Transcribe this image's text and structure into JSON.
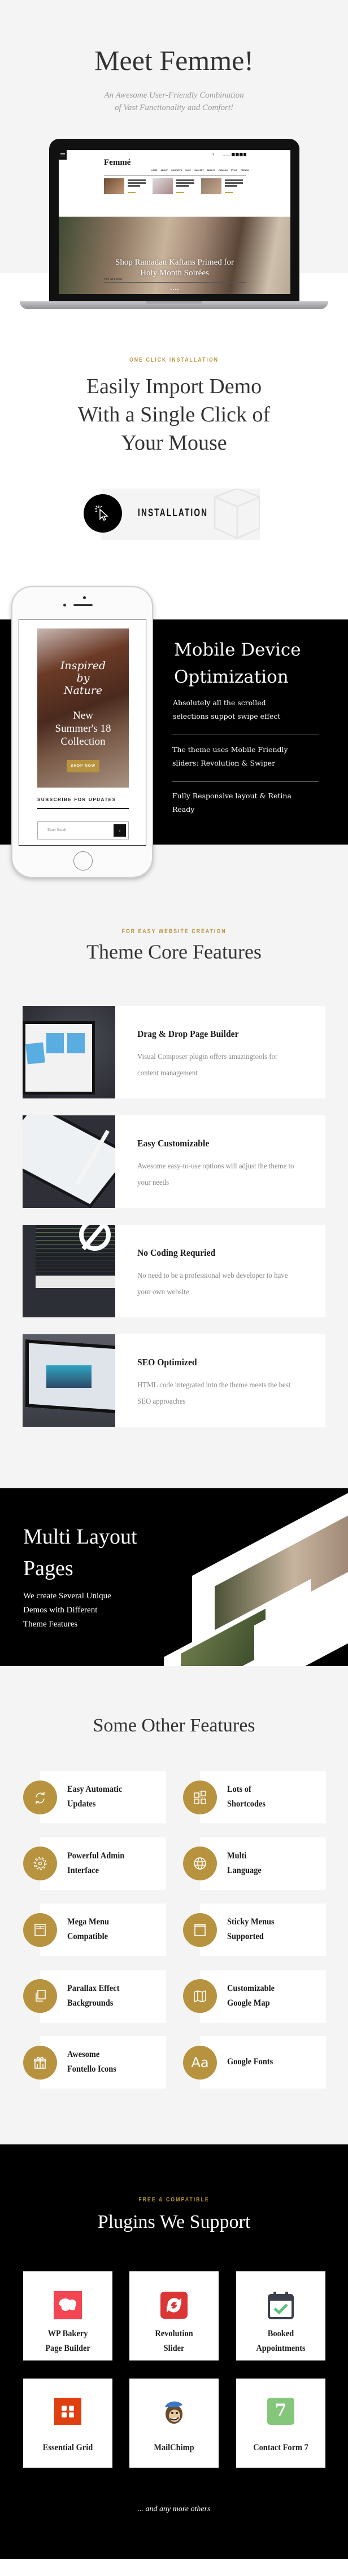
{
  "colors": {
    "accent": "#b8933f",
    "dark": "#000000",
    "light_bg": "#f4f4f4"
  },
  "hero": {
    "title": "Meet Femme!",
    "subtitle_line1": "An Awesome User-Friendly Combination",
    "subtitle_line2": "of Vast Functionality  and Comfort!"
  },
  "laptop_demo": {
    "logo": "Femmé",
    "subscribe": "Subscribe",
    "nav": [
      "HOME",
      "ABOUT",
      "CONTACTS",
      "SHOP",
      "GALLERY",
      "BEAUTY",
      "FASHION",
      "STYLE",
      "TRENDS"
    ],
    "slider_title_line1": "Shop Ramadan Kaftans Primed for",
    "slider_title_line2": "Holy Month Soirées",
    "section_label": "TOP STORIES"
  },
  "installation": {
    "label": "ONE CLICK INSTALLATION",
    "title_line1": "Easily Import Demo",
    "title_line2": "With a Single Click of",
    "title_line3": "Your Mouse",
    "button": "INSTALLATION",
    "button_icon": "cursor-click-icon"
  },
  "mobile": {
    "phone_screen": {
      "script_line1": "Inspired",
      "script_line2": "by",
      "script_line3": "Nature",
      "headline_line1": "New",
      "headline_line2": "Summer's 18",
      "headline_line3": "Collection",
      "shop_button": "SHOP NOW",
      "subscribe_label": "SUBSCRIBE FOR UPDATES",
      "email_placeholder": "Enter Email",
      "submit": "›"
    },
    "title_line1": "Mobile Device",
    "title_line2": "Optimization",
    "points": [
      {
        "line1": "Absolutely all the scrolled",
        "line2": "selections suppot swipe effect"
      },
      {
        "line1": "The theme uses Mobile Friendly",
        "line2": "sliders: Revolution & Swiper"
      },
      {
        "line1": "Fully Responsive layout & Retina",
        "line2": "Ready"
      }
    ]
  },
  "core": {
    "label": "FOR EASY WEBSITE CREATION",
    "title": "Theme Core Features",
    "items": [
      {
        "title": "Drag & Drop Page  Builder",
        "desc": "Visual  Composer plugin offers amazingtools for content management"
      },
      {
        "title": "Easy Customizable",
        "desc": "Awesome easy-to-use options will adjust the theme to your needs"
      },
      {
        "title": "No Coding Requried",
        "desc": "No need to be a professional web developer to have your own website"
      },
      {
        "title": "SEO Optimized",
        "desc": "HTML code integrated into the theme meets the best SEO approaches"
      }
    ]
  },
  "multi": {
    "title_line1": "Multi Layout",
    "title_line2": "Pages",
    "desc_line1": "We create Several Unique",
    "desc_line2": "Demos with Different",
    "desc_line3": "Theme Features"
  },
  "other": {
    "title": "Some Other Features",
    "items": [
      {
        "line1": "Easy  Automatic",
        "line2": "Updates",
        "icon": "refresh-icon"
      },
      {
        "line1": "Lots of",
        "line2": "Shortcodes",
        "icon": "shortcodes-icon"
      },
      {
        "line1": "Powerful Admin",
        "line2": "Interface",
        "icon": "gear-icon"
      },
      {
        "line1": "Multi",
        "line2": "Language",
        "icon": "globe-icon"
      },
      {
        "line1": "Mega Menu",
        "line2": "Compatible",
        "icon": "mega-menu-icon"
      },
      {
        "line1": "Sticky Menus",
        "line2": "Supported",
        "icon": "sticky-menu-icon"
      },
      {
        "line1": "Parallax Effect",
        "line2": "Backgrounds",
        "icon": "layers-icon"
      },
      {
        "line1": "Customizable",
        "line2": "Google Map",
        "icon": "map-icon"
      },
      {
        "line1": "Awesome",
        "line2": "Fontello Icons",
        "icon": "gift-icon"
      },
      {
        "line1": "Google Fonts",
        "line2": "",
        "icon": "font-icon",
        "glyph": "Aa"
      }
    ]
  },
  "plugins": {
    "label": "FREE & COMPATIBLE",
    "title": "Plugins We Support",
    "items": [
      {
        "line1": "WP Bakery",
        "line2": "Page Builder",
        "icon": "wpbakery-icon",
        "color": "#f24652"
      },
      {
        "line1": "Revolution",
        "line2": "Slider",
        "icon": "revolution-slider-icon",
        "color": "#dc3535"
      },
      {
        "line1": "Booked",
        "line2": "Appointments",
        "icon": "calendar-check-icon",
        "color": "#3a3f4b"
      },
      {
        "line1": "Essential Grid",
        "line2": "",
        "icon": "essential-grid-icon",
        "color": "#e0400f"
      },
      {
        "line1": "MailChimp",
        "line2": "",
        "icon": "mailchimp-icon",
        "color": "#6b4a2b"
      },
      {
        "line1": "Contact Form 7",
        "line2": "",
        "icon": "contact-form-icon",
        "color": "#85c77a",
        "glyph": "7"
      }
    ],
    "footer": "... and any more others"
  }
}
